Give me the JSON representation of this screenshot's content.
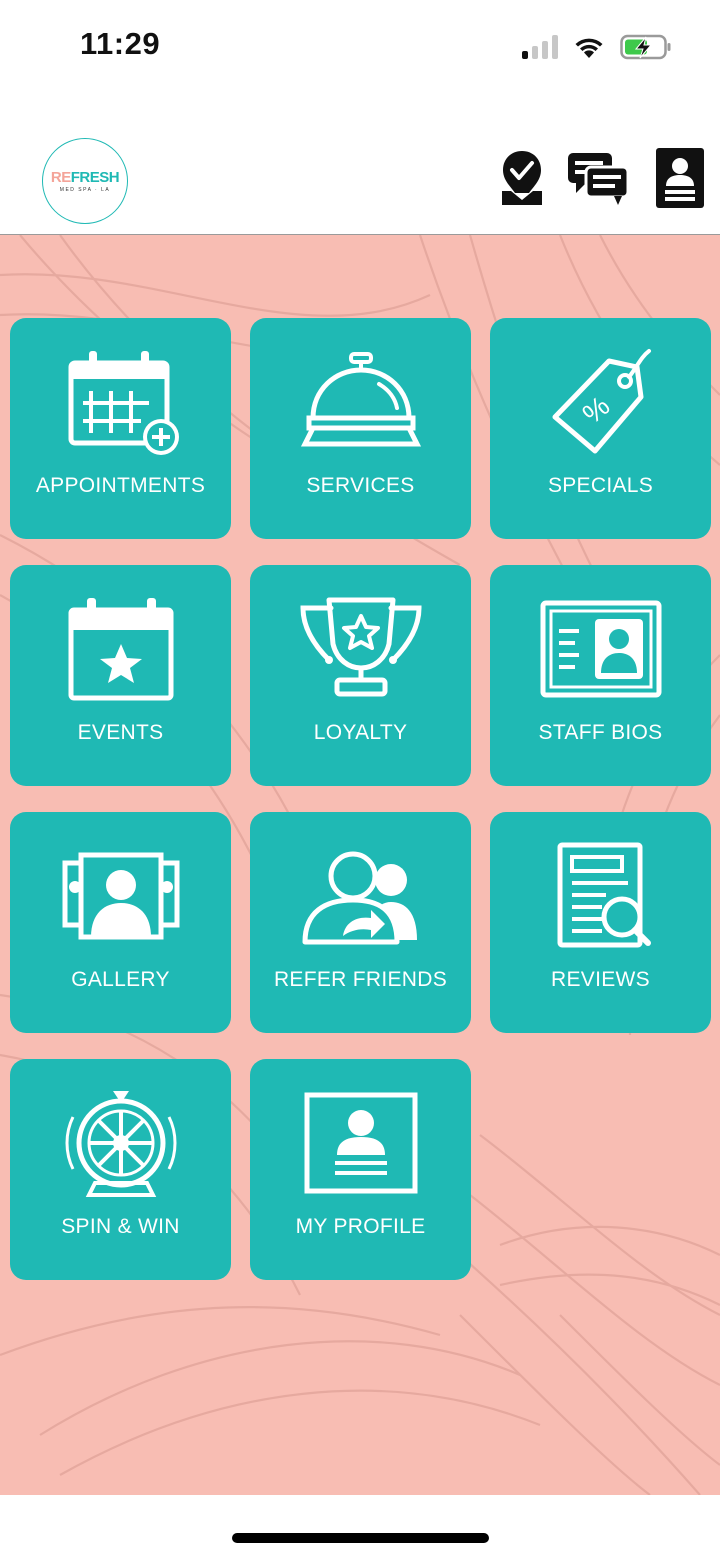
{
  "status_bar": {
    "time": "11:29",
    "icons": [
      "cellular-signal-icon",
      "wifi-icon",
      "battery-charging-icon"
    ]
  },
  "header": {
    "logo": {
      "word_part1": "RE",
      "word_part2": "FRESH",
      "tagline": "MED SPA · LA"
    },
    "actions": [
      {
        "icon": "checkin-badge-icon"
      },
      {
        "icon": "messages-icon"
      },
      {
        "icon": "contact-card-icon"
      }
    ]
  },
  "colors": {
    "tile": "#1fb9b4",
    "background": "#f8bdb3",
    "accent_pink": "#f4a499"
  },
  "menu": [
    {
      "label": "APPOINTMENTS",
      "icon": "calendar-add-icon"
    },
    {
      "label": "SERVICES",
      "icon": "service-bell-icon"
    },
    {
      "label": "SPECIALS",
      "icon": "discount-tag-icon"
    },
    {
      "label": "EVENTS",
      "icon": "calendar-star-icon"
    },
    {
      "label": "LOYALTY",
      "icon": "trophy-icon"
    },
    {
      "label": "STAFF BIOS",
      "icon": "id-card-icon"
    },
    {
      "label": "GALLERY",
      "icon": "photo-gallery-icon"
    },
    {
      "label": "REFER FRIENDS",
      "icon": "refer-users-icon"
    },
    {
      "label": "REVIEWS",
      "icon": "review-document-icon"
    },
    {
      "label": "SPIN & WIN",
      "icon": "prize-wheel-icon"
    },
    {
      "label": "MY PROFILE",
      "icon": "profile-frame-icon"
    }
  ]
}
